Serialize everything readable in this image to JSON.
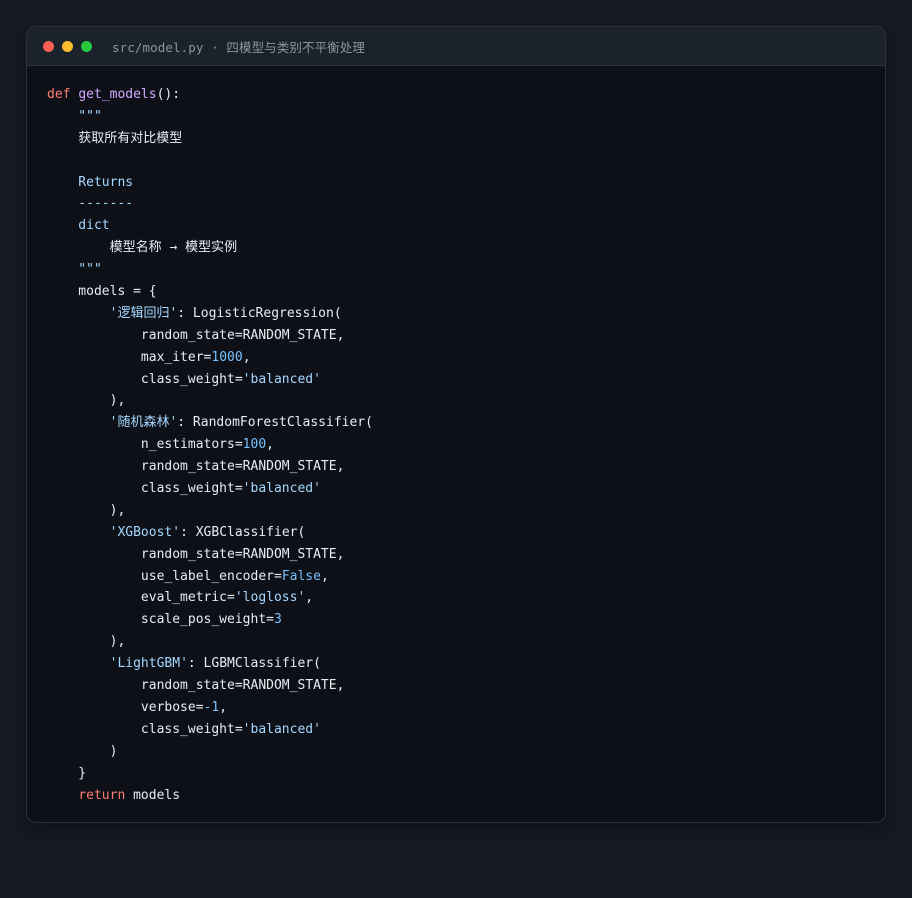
{
  "window": {
    "title": "src/model.py · 四模型与类别不平衡处理",
    "colors": {
      "background": "#161b23",
      "editor": "#0d1117",
      "keyword": "#ff7b72",
      "function": "#d2a8ff",
      "string": "#a5d6ff",
      "number": "#79c0ff",
      "text": "#e6edf3"
    }
  },
  "code": {
    "l1": {
      "def": "def",
      "name": "get_models",
      "rest": "():"
    },
    "l2": "    \"\"\"",
    "l3": "    获取所有对比模型",
    "l4": "",
    "l5": "    Returns",
    "l6": "    -------",
    "l7": "    dict",
    "l8": "        模型名称 → 模型实例",
    "l9": "    \"\"\"",
    "l10": "    models = {",
    "l11": {
      "indent": "        ",
      "key": "'逻辑回归'",
      "rest": ": LogisticRegression("
    },
    "l12": "            random_state=RANDOM_STATE,",
    "l13": {
      "pre": "            max_iter=",
      "num": "1000",
      "post": ","
    },
    "l14": {
      "pre": "            class_weight=",
      "str": "'balanced'",
      "post": ""
    },
    "l15": "        ),",
    "l16": {
      "indent": "        ",
      "key": "'随机森林'",
      "rest": ": RandomForestClassifier("
    },
    "l17": {
      "pre": "            n_estimators=",
      "num": "100",
      "post": ","
    },
    "l18": "            random_state=RANDOM_STATE,",
    "l19": {
      "pre": "            class_weight=",
      "str": "'balanced'",
      "post": ""
    },
    "l20": "        ),",
    "l21": {
      "indent": "        ",
      "key": "'XGBoost'",
      "rest": ": XGBClassifier("
    },
    "l22": "            random_state=RANDOM_STATE,",
    "l23": {
      "pre": "            use_label_encoder=",
      "num": "False",
      "post": ","
    },
    "l24": {
      "pre": "            eval_metric=",
      "str": "'logloss'",
      "post": ","
    },
    "l25": {
      "pre": "            scale_pos_weight=",
      "num": "3",
      "post": ""
    },
    "l26": "        ),",
    "l27": {
      "indent": "        ",
      "key": "'LightGBM'",
      "rest": ": LGBMClassifier("
    },
    "l28": "            random_state=RANDOM_STATE,",
    "l29": {
      "pre": "            verbose=",
      "num": "-1",
      "post": ","
    },
    "l30": {
      "pre": "            class_weight=",
      "str": "'balanced'",
      "post": ""
    },
    "l31": "        )",
    "l32": "    }",
    "l33": {
      "indent": "    ",
      "kw": "return",
      "rest": " models"
    }
  }
}
